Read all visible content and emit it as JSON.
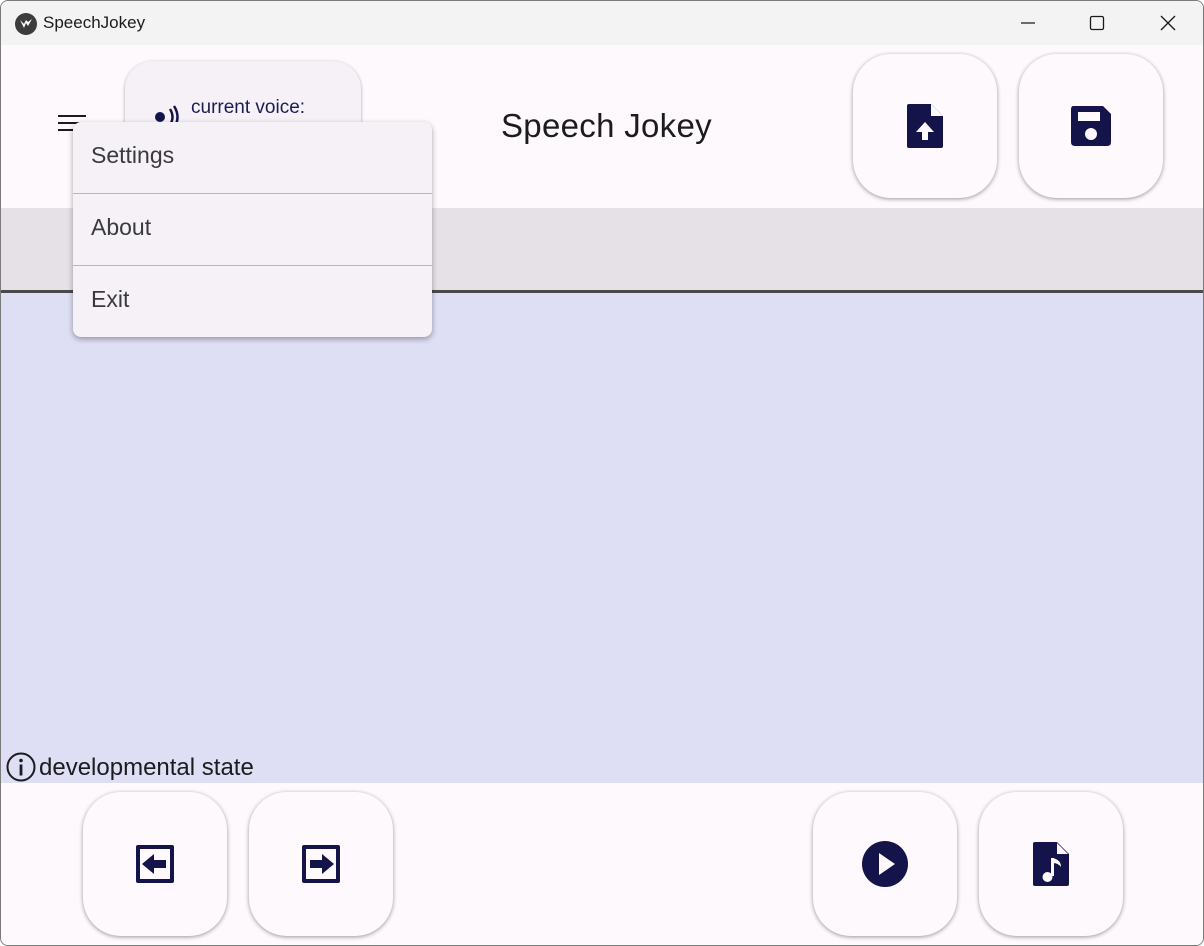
{
  "window": {
    "title": "SpeechJokey",
    "icon": "app-logo-icon",
    "controls": [
      "minimize-icon",
      "maximize-icon",
      "close-icon"
    ]
  },
  "appbar": {
    "menu_icon": "hamburger-menu-icon",
    "voice_label": "current voice:",
    "voice_icon": "voice-icon",
    "title": "Speech Jokey",
    "actions": [
      {
        "name": "upload-file-button",
        "icon": "file-upload-icon"
      },
      {
        "name": "save-button",
        "icon": "floppy-disk-icon"
      }
    ]
  },
  "menu": {
    "items": [
      {
        "label": "Settings"
      },
      {
        "label": "About"
      },
      {
        "label": "Exit"
      }
    ]
  },
  "main": {
    "status_text": "developmental state",
    "status_icon": "info-icon"
  },
  "bottombar": {
    "actions": [
      {
        "name": "previous-button",
        "icon": "arrow-left-box-icon"
      },
      {
        "name": "next-button",
        "icon": "arrow-right-box-icon"
      },
      {
        "name": "play-button",
        "icon": "play-circle-icon"
      },
      {
        "name": "audio-file-button",
        "icon": "file-music-icon"
      }
    ]
  },
  "colors": {
    "accent": "#14144a",
    "surface": "#fdf9fd",
    "tab_strip": "#e6e1e6",
    "content_area": "#dedef4",
    "menu_surface": "#f5f1f7"
  }
}
